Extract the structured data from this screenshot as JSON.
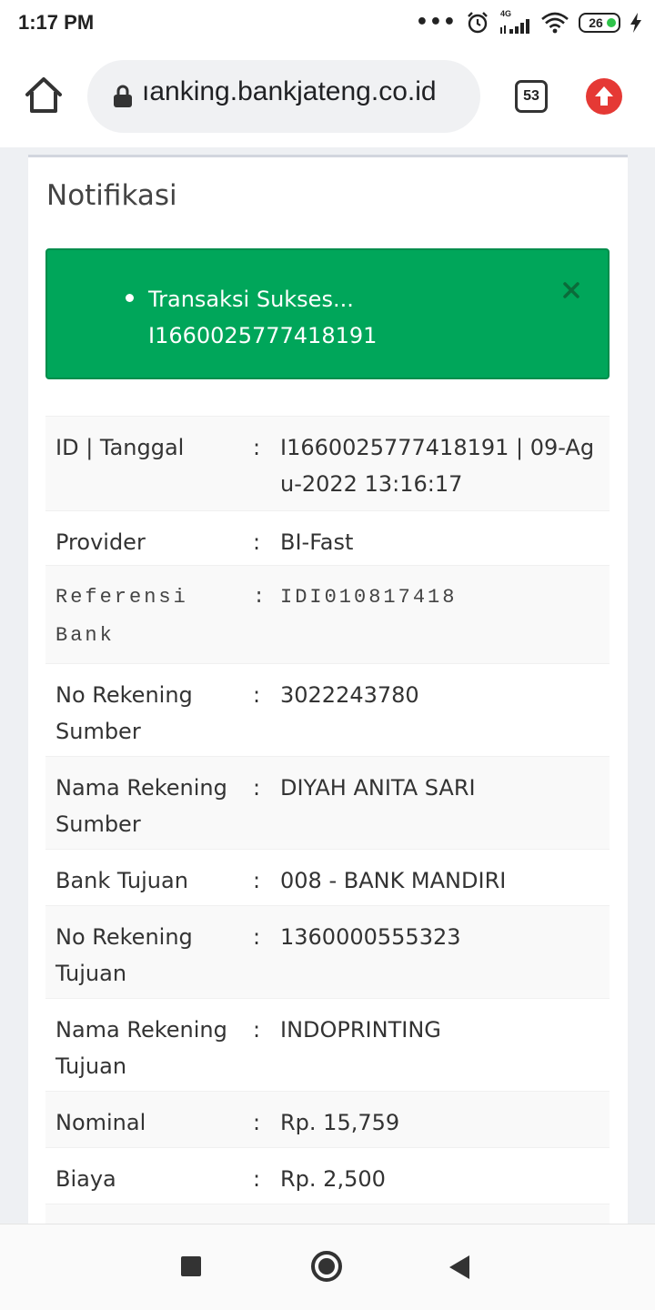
{
  "status_bar": {
    "time": "1:17 PM",
    "network": "4G",
    "battery": "26"
  },
  "browser": {
    "url": "ıanking.bankjateng.co.id",
    "tab_count": "53"
  },
  "page": {
    "title": "Notifikasi",
    "alert": {
      "message": "Transaksi Sukses... I1660025777418191",
      "color": "#00a65a"
    },
    "separator": ":",
    "rows": [
      {
        "label": "ID | Tanggal",
        "value": "I1660025777418191 | 09-Agu-2022 13:16:17"
      },
      {
        "label": "Provider",
        "value": "BI-Fast"
      },
      {
        "label": "Referensi Bank",
        "value": "IDI010817418"
      },
      {
        "label": "No Rekening Sumber",
        "value": "3022243780"
      },
      {
        "label": "Nama Rekening Sumber",
        "value": "DIYAH ANITA SARI"
      },
      {
        "label": "Bank Tujuan",
        "value": "008 - BANK MANDIRI"
      },
      {
        "label": "No Rekening Tujuan",
        "value": "1360000555323"
      },
      {
        "label": "Nama Rekening Tujuan",
        "value": "INDOPRINTING"
      },
      {
        "label": "Nominal",
        "value": "Rp. 15,759"
      },
      {
        "label": "Biaya",
        "value": "Rp. 2,500"
      }
    ]
  }
}
